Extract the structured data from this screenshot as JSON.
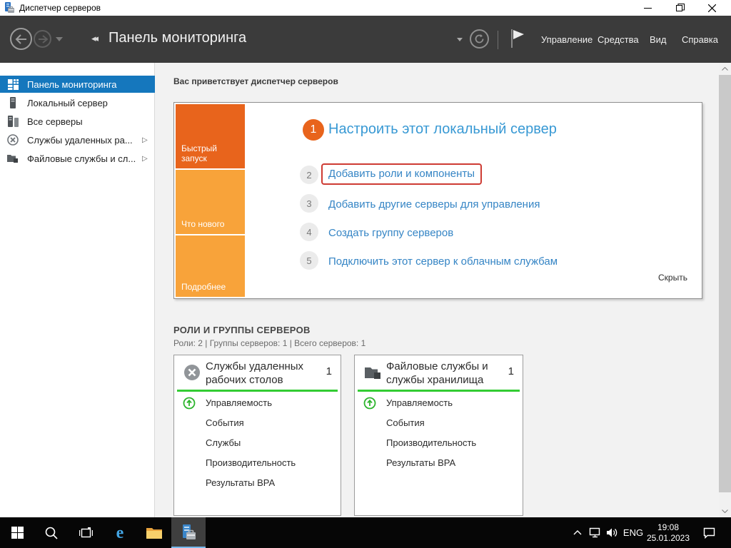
{
  "window": {
    "title": "Диспетчер серверов"
  },
  "navbar": {
    "title": "Панель мониторинга",
    "menus": [
      {
        "label": "Управление"
      },
      {
        "label": "Средства"
      },
      {
        "label": "Вид"
      },
      {
        "label": "Справка"
      }
    ]
  },
  "sidebar": {
    "items": [
      {
        "label": "Панель мониторинга",
        "selected": true
      },
      {
        "label": "Локальный сервер",
        "selected": false
      },
      {
        "label": "Все серверы",
        "selected": false
      },
      {
        "label": "Службы удаленных ра...",
        "selected": false,
        "expandable": true
      },
      {
        "label": "Файловые службы и сл...",
        "selected": false,
        "expandable": true
      }
    ]
  },
  "main": {
    "welcome_header": "Вас приветствует диспетчер серверов",
    "quickstart_tiles": [
      {
        "label": "Быстрый запуск"
      },
      {
        "label": "Что нового"
      },
      {
        "label": "Подробнее"
      }
    ],
    "tasks": [
      {
        "num": "1",
        "label": "Настроить этот локальный сервер"
      },
      {
        "num": "2",
        "label": "Добавить роли и компоненты",
        "highlighted": true
      },
      {
        "num": "3",
        "label": "Добавить другие серверы для управления"
      },
      {
        "num": "4",
        "label": "Создать группу серверов"
      },
      {
        "num": "5",
        "label": "Подключить этот сервер к облачным службам"
      }
    ],
    "hide_link": "Скрыть",
    "roles": {
      "title": "РОЛИ И ГРУППЫ СЕРВЕРОВ",
      "subtitle": "Роли: 2 | Группы серверов: 1 | Всего серверов: 1",
      "tiles": [
        {
          "title": "Службы удаленных рабочих столов",
          "count": "1",
          "items": [
            {
              "label": "Управляемость"
            },
            {
              "label": "События"
            },
            {
              "label": "Службы"
            },
            {
              "label": "Производительность"
            },
            {
              "label": "Результаты BPA"
            }
          ]
        },
        {
          "title": "Файловые службы и службы хранилища",
          "count": "1",
          "items": [
            {
              "label": "Управляемость"
            },
            {
              "label": "События"
            },
            {
              "label": "Производительность"
            },
            {
              "label": "Результаты BPA"
            }
          ]
        }
      ]
    }
  },
  "taskbar": {
    "language": "ENG",
    "time": "19:08",
    "date": "25.01.2023"
  },
  "colors": {
    "accent_blue": "#1577BD",
    "link_blue": "#3585C5",
    "heading_blue": "#3899D4",
    "orange_dark": "#E8641C",
    "orange_light": "#F8A33A",
    "green_status": "#33CC33",
    "highlight_red": "#CE3B33",
    "navbar_gray": "#3B3B3B"
  }
}
